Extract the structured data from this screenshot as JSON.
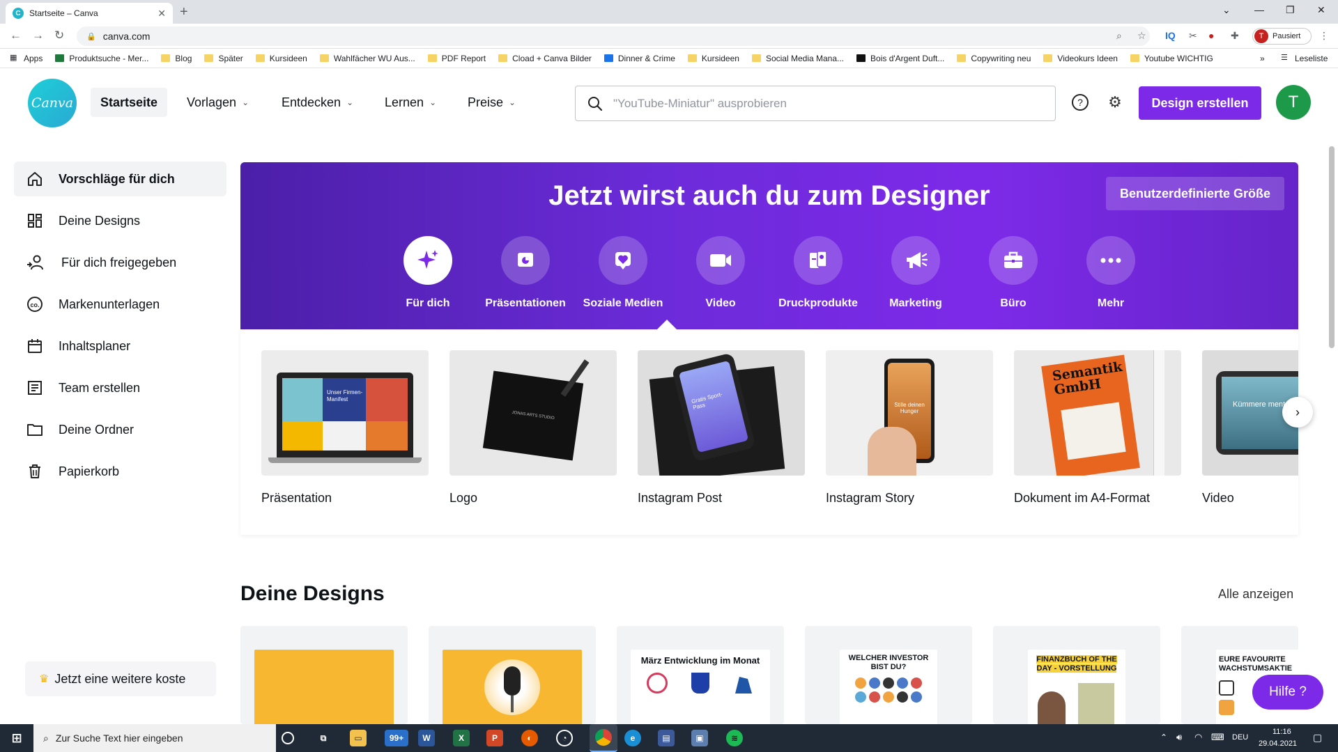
{
  "browser": {
    "tab_title": "Startseite – Canva",
    "tab_favicon": "C",
    "url": "canva.com",
    "profile_initial": "T",
    "profile_status": "Pausiert",
    "bookmarks": [
      "Apps",
      "Produktsuche - Mer...",
      "Blog",
      "Später",
      "Kursideen",
      "Wahlfächer WU Aus...",
      "PDF Report",
      "Cload + Canva Bilder",
      "Dinner & Crime",
      "Kursideen",
      "Social Media Mana...",
      "Bois d'Argent Duft...",
      "Copywriting neu",
      "Videokurs Ideen",
      "Youtube WICHTIG"
    ],
    "reading_list": "Leseliste"
  },
  "header": {
    "logo_text": "Canva",
    "nav": [
      {
        "label": "Startseite",
        "active": true
      },
      {
        "label": "Vorlagen"
      },
      {
        "label": "Entdecken"
      },
      {
        "label": "Lernen"
      },
      {
        "label": "Preise"
      }
    ],
    "search_placeholder": "\"YouTube-Miniatur\" ausprobieren",
    "cta": "Design erstellen",
    "user_initial": "T"
  },
  "sidebar": {
    "items": [
      {
        "label": "Vorschläge für dich",
        "icon": "home-icon",
        "active": true
      },
      {
        "label": "Deine Designs",
        "icon": "grid-icon"
      },
      {
        "label": "Für dich freigegeben",
        "icon": "shared-users-icon"
      },
      {
        "label": "Markenunterlagen",
        "icon": "brand-kit-icon"
      },
      {
        "label": "Inhaltsplaner",
        "icon": "calendar-icon"
      },
      {
        "label": "Team erstellen",
        "icon": "team-icon"
      },
      {
        "label": "Deine Ordner",
        "icon": "folder-icon"
      },
      {
        "label": "Papierkorb",
        "icon": "trash-icon"
      }
    ],
    "promo": "Jetzt eine weitere koste"
  },
  "banner": {
    "title": "Jetzt wirst auch du zum Designer",
    "custom_size": "Benutzerdefinierte Größe",
    "categories": [
      {
        "label": "Für dich",
        "icon": "sparkle-icon",
        "active": true
      },
      {
        "label": "Präsentationen",
        "icon": "presentation-icon"
      },
      {
        "label": "Soziale Medien",
        "icon": "heart-icon"
      },
      {
        "label": "Video",
        "icon": "video-camera-icon"
      },
      {
        "label": "Druckprodukte",
        "icon": "print-icon"
      },
      {
        "label": "Marketing",
        "icon": "megaphone-icon"
      },
      {
        "label": "Büro",
        "icon": "briefcase-icon"
      },
      {
        "label": "Mehr",
        "icon": "more-dots-icon"
      }
    ]
  },
  "templates": {
    "items": [
      {
        "label": "Präsentation",
        "thumb_text": "Unser Firmen-Manifest"
      },
      {
        "label": "Logo",
        "thumb_text": "JONAS ARTS STUDIO"
      },
      {
        "label": "Instagram Post",
        "thumb_text": "Gratis Sport-Pass"
      },
      {
        "label": "Instagram Story",
        "thumb_text": "Stille deinen Hunger"
      },
      {
        "label": "Dokument im A4-Format",
        "thumb_text": "Semantik GmbH"
      },
      {
        "label": "Video",
        "thumb_text": "Kümmere mentale"
      }
    ]
  },
  "designs": {
    "title": "Deine Designs",
    "show_all": "Alle anzeigen",
    "items": [
      {
        "text": ""
      },
      {
        "text": ""
      },
      {
        "text": "März Entwicklung im Monat"
      },
      {
        "text": "WELCHER INVESTOR BIST DU?"
      },
      {
        "text": "FINANZBUCH OF THE DAY - VORSTELLUNG"
      },
      {
        "text": "EURE FAVOURITE WACHSTUMSAKTIE"
      }
    ]
  },
  "help_button": "Hilfe ?",
  "taskbar": {
    "search_placeholder": "Zur Suche Text hier eingeben",
    "mail_badge": "99+",
    "lang": "DEU",
    "time": "11:16",
    "date": "29.04.2021"
  },
  "colors": {
    "brand_purple": "#7d2ae8",
    "canva_teal": "#20c4cb",
    "avatar_green": "#1c9a4a"
  }
}
